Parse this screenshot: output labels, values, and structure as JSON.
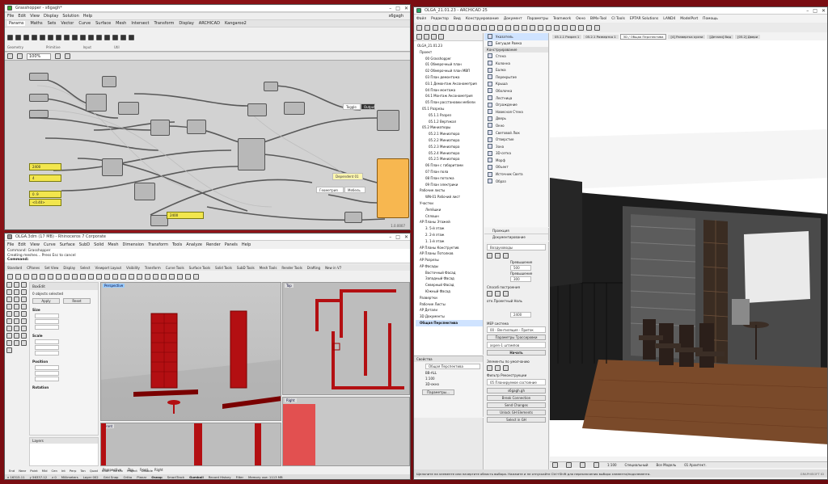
{
  "gh": {
    "title": "Grasshopper - s6gagh*",
    "menus": [
      "File",
      "Edit",
      "View",
      "Display",
      "Solution",
      "Help"
    ],
    "right_label": "s6gagh",
    "tabs": [
      "Params",
      "Maths",
      "Sets",
      "Vector",
      "Curve",
      "Surface",
      "Mesh",
      "Intersect",
      "Transform",
      "Display",
      "ARCHICAD",
      "Kangaroo2"
    ],
    "sections": [
      "Geometry",
      "Primitive",
      "Input",
      "Util"
    ],
    "zoom": "100%",
    "sliders": [
      "2400",
      "4",
      "0 .9",
      "<0.40>",
      "2400"
    ],
    "panels": [
      "Toggle",
      "Output",
      "Dependent 01",
      "Геометрия",
      "Fn-Lipson",
      "Мебель"
    ],
    "status": "1.0.0007"
  },
  "rhino": {
    "title": "OLGA.3dm (17 MB) - Rhinoceros 7 Corporate",
    "menus": [
      "File",
      "Edit",
      "View",
      "Curve",
      "Surface",
      "SubD",
      "Solid",
      "Mesh",
      "Dimension",
      "Transform",
      "Tools",
      "Analyze",
      "Render",
      "Panels",
      "Help"
    ],
    "cmd1": "Command: Grasshopper",
    "cmd2": "Creating meshes... Press Esc to cancel",
    "cmd3": "Command:",
    "tabs": [
      "Standard",
      "CPlanes",
      "Set View",
      "Display",
      "Select",
      "Viewport Layout",
      "Visibility",
      "Transform",
      "Curve Tools",
      "Surface Tools",
      "Solid Tools",
      "SubD Tools",
      "Mesh Tools",
      "Render Tools",
      "Drafting",
      "New in V7"
    ],
    "panel_title": "BoxEdit",
    "selected": "0 objects selected",
    "apply": "Apply",
    "reset": "Reset",
    "size": "Size",
    "scale": "Scale",
    "position": "Position",
    "rotation": "Rotation",
    "layers": "Layers",
    "viewports": [
      "Perspective",
      "Top",
      "Front",
      "Right"
    ],
    "vp_tabs": [
      "Perspective",
      "Top",
      "Front",
      "Right"
    ],
    "osnaps": [
      "End",
      "Near",
      "Point",
      "Mid",
      "Cen",
      "Int",
      "Perp",
      "Tan",
      "Quad",
      "Knot",
      "Vertex",
      "Project",
      "Disable"
    ],
    "status": [
      "x 16315.11",
      "y 56337.12",
      "z 0",
      "Millimeters",
      "Layer 002",
      "Grid Snap",
      "Ortho",
      "Planar",
      "Osnap",
      "SmartTrack",
      "Gumball",
      "Record History",
      "Filter",
      "Memory use: 1113 MB"
    ]
  },
  "ac": {
    "title": "OLGA_21.01.23 - ARCHICAD 25",
    "menus": [
      "Файл",
      "Редактор",
      "Вид",
      "Конструирование",
      "Документ",
      "Параметры",
      "Teamwork",
      "Окно",
      "BIMx-Tool",
      "CI Tools",
      "EPTAR Solutions",
      "LAND4",
      "ModelPort",
      "Помощь"
    ],
    "doc_tabs": [
      "05.1.1 Разрез 1",
      "05.2.1 Развертка 1",
      "3D / Общая Перспектива",
      "[4] Развертка кухни",
      "[Детали] Вид",
      "[05.2] Двери"
    ],
    "tree": [
      "OLGA_21.01.23",
      "Проект",
      "00 Grasshopper",
      "01 Обмерочный план",
      "02 Обмерочный план МВП",
      "03 План демонтажа",
      "03.1 Демонтаж Аксонометрия",
      "04 План монтажа",
      "04.1 Монтаж Аксонометрия",
      "05 План расстановки мебели",
      "05.1 Разрезы",
      "05.1.1 Разрез",
      "05.1.2 Вертикал",
      "05.2 Миниатюры",
      "05.2.1 Миниатюра",
      "05.2.2 Миниатюра",
      "05.2.3 Миниатюра",
      "05.2.4 Миниатюра",
      "05.2.5 Миниатюра",
      "06 План с габаритами",
      "07 План пола",
      "08 План потолка",
      "09 План электрики",
      "Рабочие листы",
      "WN-01 Рабочий лист",
      "Участки",
      "Лепёшки",
      "Сплошн",
      "AP Планы Этажей",
      "3. 5-й этаж",
      "2. 2-й этаж",
      "1. 1-й этаж",
      "AP Планы Конструктив",
      "AP Планы Потолков",
      "AP Разрезы",
      "AP Фасады",
      "Восточный Фасад",
      "Западный Фасад",
      "Северный Фасад",
      "Южный Фасад",
      "Развертки",
      "Рабочие Листы",
      "AP Детали",
      "3D Документы",
      "Общая Перспектива"
    ],
    "props_label": "Свойства",
    "props": [
      "Общая Перспектива",
      "ВВ-ALL",
      "1:100",
      "3D-окно"
    ],
    "params_btn": "Параметры...",
    "tools_header": "Конструирование",
    "tools": [
      "Указатель",
      "Бегущая Рамка",
      "Стена",
      "Колонна",
      "Балка",
      "Перекрытие",
      "Крыша",
      "Оболочка",
      "Лестница",
      "Ограждение",
      "Навесная Стена",
      "Дверь",
      "Окно",
      "Световой Люк",
      "Отверстие",
      "Зона",
      "3D-сетка",
      "Морф",
      "Объект",
      "Источник Света",
      "Образ"
    ],
    "right_sections": [
      "Проекция",
      "Документирование"
    ],
    "combo_story": "Воздуховоды",
    "lbl_val1": "Превышение",
    "val1": "500",
    "lbl_val2": "Превышение",
    "val2": "300",
    "lbl_construct": "Способ построения",
    "lbl_origin": "отн.Проектный Ноль",
    "val3": "2400",
    "lbl_mep": "МЕР система",
    "combo_mep": "00 - Вентиляция - Приток",
    "btn_tracing": "Параметры Трассировки",
    "combo_layer": "aspen-1 штампов",
    "btn_cancel": "Начать",
    "lbl_elements": "Элементы по умолчанию",
    "lbl_filter": "Фильтр Реконструкции",
    "combo_filter": "05 Планируемое состояние",
    "gh_conn": [
      "s6gagh.gh",
      "Break Connection",
      "Send Changes",
      "Unlock GH Elements",
      "Select in GH"
    ],
    "status": "Щелкните на элементе или начертите область выбора. Нажмите и не отпускайте Ctrl+Shift для переключения выбора элемента/подэлемента.",
    "bottom": [
      "1:100",
      "Специальный",
      "Все Модель",
      "01 Архитект.",
      "GRAPHISOFT ID"
    ]
  },
  "colors": {
    "gh_bg": "#d2d2d2",
    "red_obj": "#c41414",
    "gh_orange": "#f7b750",
    "gh_yellow": "#f2e64d",
    "desktop": "#7a0d12"
  }
}
